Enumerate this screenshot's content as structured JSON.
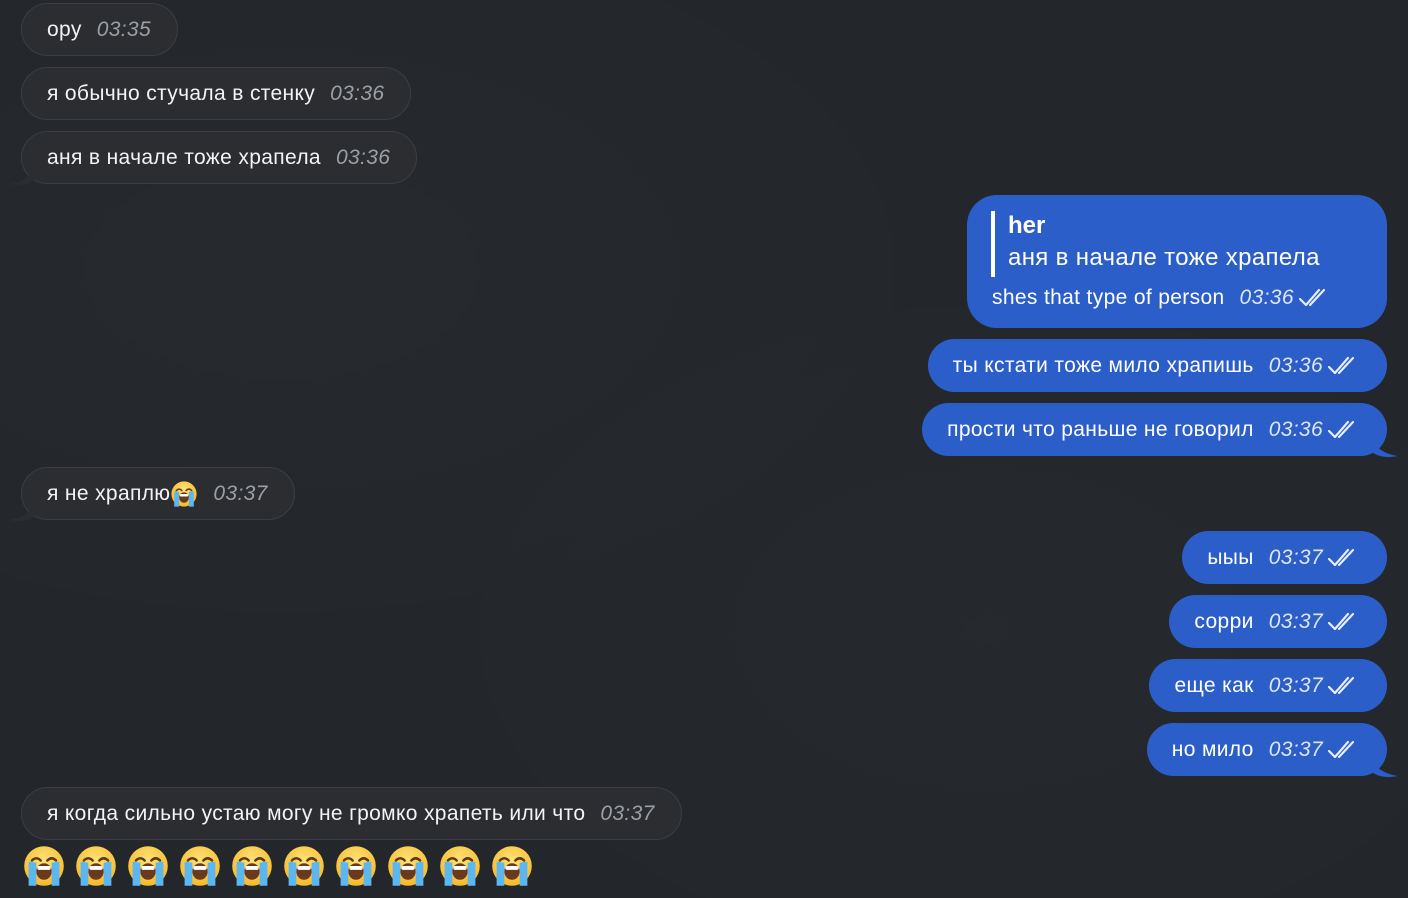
{
  "chat": {
    "messages": [
      {
        "text": "ору",
        "time": "03:35"
      },
      {
        "text": "я обычно стучала в стенку",
        "time": "03:36"
      },
      {
        "text": "аня в начале тоже храпела",
        "time": "03:36"
      },
      {
        "reply_author": "her",
        "reply_text": "аня в начале тоже храпела",
        "text": "shes that type of person",
        "time": "03:36"
      },
      {
        "text": "ты кстати тоже мило храпишь",
        "time": "03:36"
      },
      {
        "text": "прости что раньше не говорил",
        "time": "03:36"
      },
      {
        "text": "я не храплю",
        "time": "03:37"
      },
      {
        "text": "ыыы",
        "time": "03:37"
      },
      {
        "text": "сорри",
        "time": "03:37"
      },
      {
        "text": "еще как",
        "time": "03:37"
      },
      {
        "text": "но мило",
        "time": "03:37"
      },
      {
        "text": "я когда сильно устаю могу не громко храпеть или что",
        "time": "03:37"
      }
    ],
    "emoji_row": [
      "😭",
      "😭",
      "😭",
      "😭",
      "😭",
      "😭",
      "😭",
      "😭",
      "😭",
      "😭"
    ]
  },
  "colors": {
    "background": "#23272b",
    "incoming_bubble": "#2b2d30",
    "outgoing_bubble": "#2c5ec9"
  },
  "icons": {
    "read_receipt": "double-check-icon",
    "emoji": "loudly-crying-face-icon"
  }
}
